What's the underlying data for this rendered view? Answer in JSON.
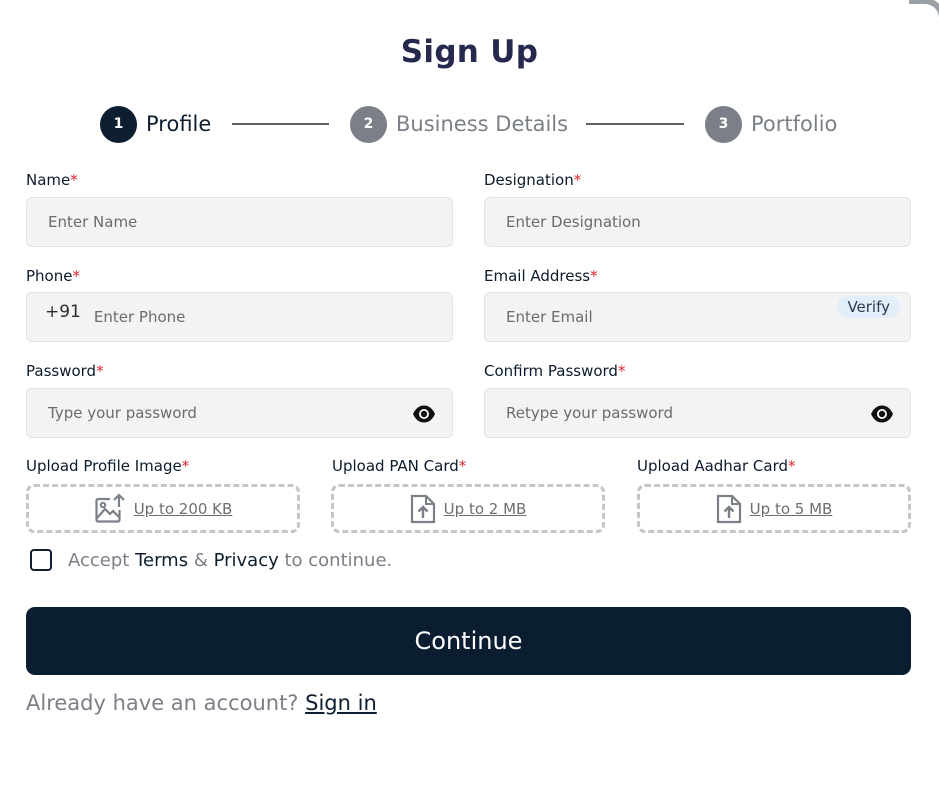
{
  "title": "Sign Up",
  "steps": [
    {
      "number": "1",
      "label": "Profile",
      "active": true
    },
    {
      "number": "2",
      "label": "Business Details",
      "active": false
    },
    {
      "number": "3",
      "label": "Portfolio",
      "active": false
    }
  ],
  "required_marker": "*",
  "fields": {
    "name": {
      "label": "Name",
      "placeholder": "Enter Name"
    },
    "designation": {
      "label": "Designation",
      "placeholder": "Enter Designation"
    },
    "phone": {
      "label": "Phone",
      "prefix": "+91",
      "placeholder": "Enter Phone"
    },
    "email": {
      "label": "Email Address",
      "placeholder": "Enter Email",
      "verify_label": "Verify"
    },
    "password": {
      "label": "Password",
      "placeholder": "Type your password"
    },
    "confirm_password": {
      "label": "Confirm Password",
      "placeholder": "Retype your password"
    }
  },
  "uploads": {
    "profile_image": {
      "label": "Upload Profile Image",
      "limit": "Up to 200 KB",
      "icon": "image-upload-icon"
    },
    "pan_card": {
      "label": "Upload PAN Card",
      "limit": "Up to 2 MB",
      "icon": "file-upload-icon"
    },
    "aadhar_card": {
      "label": "Upload Aadhar Card",
      "limit": "Up to 5 MB",
      "icon": "file-upload-icon"
    }
  },
  "terms": {
    "prefix": "Accept ",
    "terms_link": "Terms",
    "amp": " & ",
    "privacy_link": "Privacy",
    "suffix": " to continue.",
    "checked": false
  },
  "continue_label": "Continue",
  "signin": {
    "prompt": "Already have an account? ",
    "link": "Sign in"
  },
  "colors": {
    "primary": "#0b1e31",
    "title": "#25294e",
    "inactive_step": "#7b7f87",
    "required": "#e0242f",
    "input_bg": "#f3f3f3",
    "verify_bg": "#e3eefb"
  }
}
